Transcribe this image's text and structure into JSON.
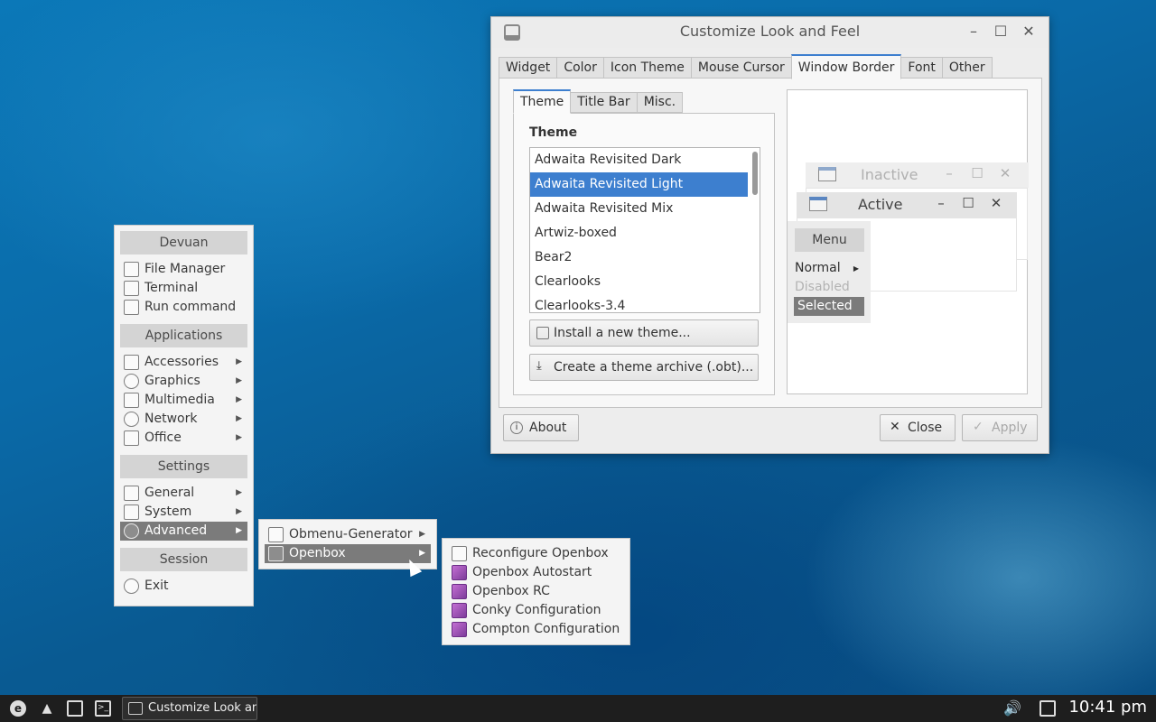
{
  "root_menu": {
    "sections": [
      {
        "title": "Devuan",
        "items": [
          {
            "label": "File Manager",
            "icon": "file-manager-icon"
          },
          {
            "label": "Terminal",
            "icon": "terminal-icon"
          },
          {
            "label": "Run command",
            "icon": "run-command-icon"
          }
        ]
      },
      {
        "title": "Applications",
        "items": [
          {
            "label": "Accessories",
            "icon": "accessories-icon",
            "submenu": true
          },
          {
            "label": "Graphics",
            "icon": "graphics-icon",
            "submenu": true
          },
          {
            "label": "Multimedia",
            "icon": "multimedia-icon",
            "submenu": true
          },
          {
            "label": "Network",
            "icon": "network-icon",
            "submenu": true
          },
          {
            "label": "Office",
            "icon": "office-icon",
            "submenu": true
          }
        ]
      },
      {
        "title": "Settings",
        "items": [
          {
            "label": "General",
            "icon": "general-icon",
            "submenu": true
          },
          {
            "label": "System",
            "icon": "system-icon",
            "submenu": true
          },
          {
            "label": "Advanced",
            "icon": "gear-icon",
            "submenu": true,
            "selected": true
          }
        ]
      },
      {
        "title": "Session",
        "items": [
          {
            "label": "Exit",
            "icon": "power-icon"
          }
        ]
      }
    ]
  },
  "advanced_menu": {
    "items": [
      {
        "label": "Obmenu-Generator",
        "icon": "obmenu-generator-icon",
        "submenu": true
      },
      {
        "label": "Openbox",
        "icon": "openbox-icon",
        "submenu": true,
        "selected": true
      }
    ]
  },
  "openbox_menu": {
    "items": [
      {
        "label": "Reconfigure Openbox",
        "icon": "reconfigure-icon"
      },
      {
        "label": "Openbox Autostart",
        "icon": "text-editor-icon"
      },
      {
        "label": "Openbox RC",
        "icon": "text-editor-icon"
      },
      {
        "label": "Conky Configuration",
        "icon": "text-editor-icon"
      },
      {
        "label": "Compton Configuration",
        "icon": "text-editor-icon"
      }
    ]
  },
  "dialog": {
    "title": "Customize Look and Feel",
    "tabs": [
      "Widget",
      "Color",
      "Icon Theme",
      "Mouse Cursor",
      "Window Border",
      "Font",
      "Other"
    ],
    "active_tab": "Window Border",
    "subtabs": [
      "Theme",
      "Title Bar",
      "Misc."
    ],
    "active_subtab": "Theme",
    "section_label": "Theme",
    "themes": [
      "Adwaita Revisited Dark",
      "Adwaita Revisited Light",
      "Adwaita Revisited Mix",
      "Artwiz-boxed",
      "Bear2",
      "Clearlooks",
      "Clearlooks-3.4"
    ],
    "selected_theme": "Adwaita Revisited Light",
    "install_button": "Install a new theme...",
    "archive_button": "Create a theme archive (.obt)...",
    "about_button": "About",
    "close_button": "Close",
    "apply_button": "Apply",
    "preview": {
      "inactive_title": "Inactive",
      "active_title": "Active",
      "menu_title": "Menu",
      "menu_normal": "Normal",
      "menu_disabled": "Disabled",
      "menu_selected": "Selected"
    }
  },
  "taskbar": {
    "task_label": "Customize Look an...",
    "clock": "10:41 pm"
  },
  "colors": {
    "accent": "#3d7fcf",
    "menu_selected": "#7b7b7b",
    "taskbar": "#1e1e1e"
  }
}
